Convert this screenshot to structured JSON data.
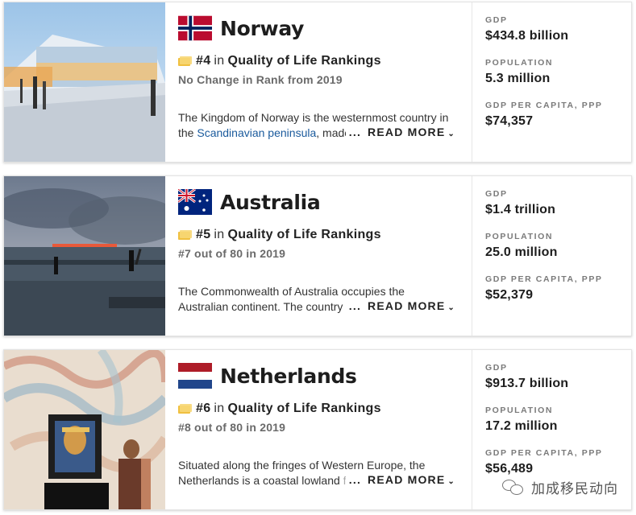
{
  "cards": [
    {
      "country": "Norway",
      "rank": "#4",
      "rank_in": "in",
      "rank_list": "Quality of Life Rankings",
      "change": "No Change in Rank from 2019",
      "desc_line1": "The Kingdom of Norway is the westernmost country in",
      "desc_line2_pre": "the ",
      "desc_link": "Scandinavian peninsula",
      "desc_line2_post": ", made",
      "read_more": "READ MORE",
      "dots": "...",
      "stats": [
        {
          "label": "GDP",
          "value": "$434.8 billion"
        },
        {
          "label": "POPULATION",
          "value": "5.3 million"
        },
        {
          "label": "GDP PER CAPITA, PPP",
          "value": "$74,357"
        }
      ]
    },
    {
      "country": "Australia",
      "rank": "#5",
      "rank_in": "in",
      "rank_list": "Quality of Life Rankings",
      "change": "#7 out of 80 in 2019",
      "desc_line1": "The Commonwealth of Australia occupies the",
      "desc_line2_pre": "Australian continent. The country ",
      "desc_line2_fade": "a",
      "read_more": "READ MORE",
      "dots": "...",
      "stats": [
        {
          "label": "GDP",
          "value": "$1.4 trillion"
        },
        {
          "label": "POPULATION",
          "value": "25.0 million"
        },
        {
          "label": "GDP PER CAPITA, PPP",
          "value": "$52,379"
        }
      ]
    },
    {
      "country": "Netherlands",
      "rank": "#6",
      "rank_in": "in",
      "rank_list": "Quality of Life Rankings",
      "change": "#8 out of 80 in 2019",
      "desc_line1": "Situated along the fringes of Western Europe, the",
      "desc_line2_pre": "Netherlands is a coastal lowland ",
      "desc_line2_fade": "fr",
      "read_more": "READ MORE",
      "dots": "...",
      "stats": [
        {
          "label": "GDP",
          "value": "$913.7 billion"
        },
        {
          "label": "POPULATION",
          "value": "17.2 million"
        },
        {
          "label": "GDP PER CAPITA, PPP",
          "value": "$56,489"
        }
      ]
    }
  ],
  "watermark": "加成移民动向",
  "colors": {
    "link": "#1a5a9c",
    "ticket": "#f0c040"
  }
}
